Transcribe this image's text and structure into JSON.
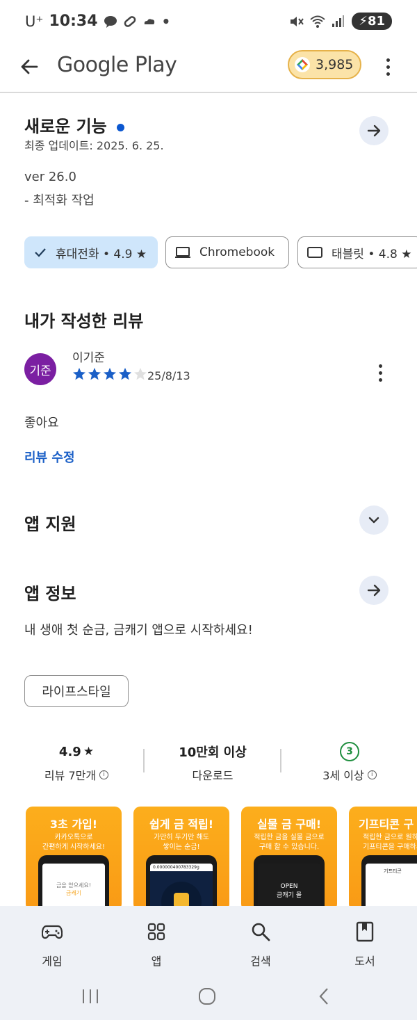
{
  "status_bar": {
    "carrier": "U⁺",
    "time": "10:34",
    "battery": "81"
  },
  "app_bar": {
    "title": "Google Play",
    "points": "3,985"
  },
  "whats_new": {
    "title": "새로운 기능",
    "updated": "최종 업데이트: 2025. 6. 25.",
    "version": "ver 26.0",
    "note": "- 최적화 작업"
  },
  "device_chips": [
    {
      "label": "휴대전화 • 4.9 ★",
      "selected": true,
      "icon": "check-icon"
    },
    {
      "label": "Chromebook",
      "selected": false,
      "icon": "laptop-icon"
    },
    {
      "label": "태블릿 • 4.8 ★",
      "selected": false,
      "icon": "tablet-icon"
    }
  ],
  "my_review": {
    "title": "내가 작성한 리뷰",
    "avatar_text": "기준",
    "author": "이기준",
    "rating": 4,
    "date": "25/8/13",
    "text": "좋아요",
    "edit_label": "리뷰 수정"
  },
  "app_support": {
    "title": "앱 지원"
  },
  "app_info": {
    "title": "앱 정보",
    "description": "내 생애 첫 순금, 금캐기 앱으로 시작하세요!",
    "category": "라이프스타일"
  },
  "stats": {
    "rating_value": "4.9",
    "rating_label": "리뷰 7만개",
    "downloads_value": "10만회 이상",
    "downloads_label": "다운로드",
    "age_value": "3",
    "age_label": "3세 이상"
  },
  "screenshots": [
    {
      "headline": "3초 가입!",
      "sub1": "카카오톡으로",
      "sub2": "간편하게 시작하세요!",
      "screen_text1": "금을 얻으세요!",
      "screen_text2": "금캐기"
    },
    {
      "headline": "쉽게 금 적립!",
      "sub1": "가만히 두기만 해도",
      "sub2": "쌓이는 순금!",
      "screen_text1": "0.000000400783329g",
      "screen_text2": ""
    },
    {
      "headline": "실물 금 구매!",
      "sub1": "적립한 금을 실물 금으로",
      "sub2": "구매 할 수 있습니다.",
      "screen_text1": "OPEN",
      "screen_text2": "금캐기 몰"
    },
    {
      "headline": "기프티콘 구",
      "sub1": "적립한 금으로 원하",
      "sub2": "기프티콘을 구매하세",
      "screen_text1": "기프티콘",
      "screen_text2": ""
    }
  ],
  "bottom_nav": [
    {
      "label": "게임",
      "icon": "gamepad-icon"
    },
    {
      "label": "앱",
      "icon": "apps-icon"
    },
    {
      "label": "검색",
      "icon": "search-icon"
    },
    {
      "label": "도서",
      "icon": "book-icon"
    }
  ],
  "colors": {
    "accent_blue": "#0b57d0",
    "chip_selected": "#cfe6fb",
    "star_blue": "#1a5fc7",
    "avatar_purple": "#7b1fa2",
    "screenshot_orange": "#fcae1c"
  }
}
